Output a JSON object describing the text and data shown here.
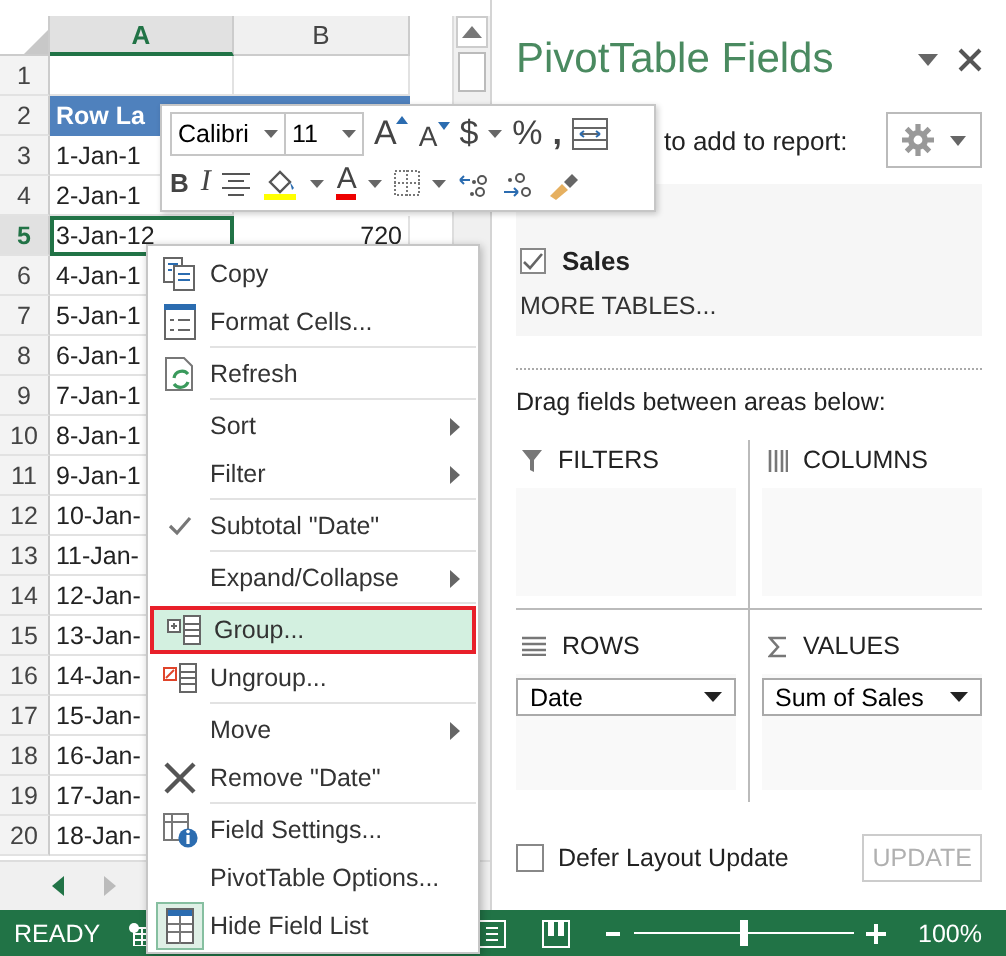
{
  "sheet": {
    "columns": [
      {
        "label": "A",
        "selected": true
      },
      {
        "label": "B",
        "selected": false
      }
    ],
    "rows": [
      {
        "number": "1",
        "kind": "blank",
        "selected": false
      },
      {
        "number": "2",
        "kind": "header",
        "a": "Row La",
        "selected": false
      },
      {
        "number": "3",
        "kind": "data",
        "a": "1-Jan-1",
        "selected": false
      },
      {
        "number": "4",
        "kind": "data",
        "a": "2-Jan-1",
        "selected": false
      },
      {
        "number": "5",
        "kind": "data",
        "a": "3-Jan-12",
        "b": "720",
        "selected": true
      },
      {
        "number": "6",
        "kind": "data",
        "a": "4-Jan-1",
        "selected": false
      },
      {
        "number": "7",
        "kind": "data",
        "a": "5-Jan-1",
        "selected": false
      },
      {
        "number": "8",
        "kind": "data",
        "a": "6-Jan-1",
        "selected": false
      },
      {
        "number": "9",
        "kind": "data",
        "a": "7-Jan-1",
        "selected": false
      },
      {
        "number": "10",
        "kind": "data",
        "a": "8-Jan-1",
        "selected": false
      },
      {
        "number": "11",
        "kind": "data",
        "a": "9-Jan-1",
        "selected": false
      },
      {
        "number": "12",
        "kind": "data",
        "a": "10-Jan-",
        "selected": false
      },
      {
        "number": "13",
        "kind": "data",
        "a": "11-Jan-",
        "selected": false
      },
      {
        "number": "14",
        "kind": "data",
        "a": "12-Jan-",
        "selected": false
      },
      {
        "number": "15",
        "kind": "data",
        "a": "13-Jan-",
        "selected": false
      },
      {
        "number": "16",
        "kind": "data",
        "a": "14-Jan-",
        "selected": false
      },
      {
        "number": "17",
        "kind": "data",
        "a": "15-Jan-",
        "selected": false
      },
      {
        "number": "18",
        "kind": "data",
        "a": "16-Jan-",
        "selected": false
      },
      {
        "number": "19",
        "kind": "data",
        "a": "17-Jan-",
        "selected": false
      },
      {
        "number": "20",
        "kind": "data",
        "a": "18-Jan-",
        "selected": false
      }
    ]
  },
  "mini_toolbar": {
    "font_name": "Calibri",
    "font_size": "11",
    "grow_font": "A",
    "shrink_font": "A",
    "currency": "$",
    "percent": "%",
    "comma": ",",
    "bold": "B",
    "italic": "I",
    "font_color": "A"
  },
  "context_menu": {
    "items": [
      {
        "kind": "item",
        "label": "Copy",
        "submenu": false,
        "checked": false,
        "selected": false
      },
      {
        "kind": "item",
        "label": "Format Cells...",
        "submenu": false,
        "checked": false,
        "selected": false
      },
      {
        "kind": "separator"
      },
      {
        "kind": "item",
        "label": "Refresh",
        "submenu": false,
        "checked": false,
        "selected": false
      },
      {
        "kind": "separator"
      },
      {
        "kind": "item",
        "label": "Sort",
        "submenu": true,
        "checked": false,
        "selected": false
      },
      {
        "kind": "item",
        "label": "Filter",
        "submenu": true,
        "checked": false,
        "selected": false
      },
      {
        "kind": "separator"
      },
      {
        "kind": "item",
        "label": "Subtotal \"Date\"",
        "submenu": false,
        "checked": true,
        "selected": false
      },
      {
        "kind": "separator"
      },
      {
        "kind": "item",
        "label": "Expand/Collapse",
        "submenu": true,
        "checked": false,
        "selected": false
      },
      {
        "kind": "separator"
      },
      {
        "kind": "item",
        "label": "Group...",
        "submenu": false,
        "checked": false,
        "selected": true
      },
      {
        "kind": "item",
        "label": "Ungroup...",
        "submenu": false,
        "checked": false,
        "selected": false
      },
      {
        "kind": "separator"
      },
      {
        "kind": "item",
        "label": "Move",
        "submenu": true,
        "checked": false,
        "selected": false
      },
      {
        "kind": "item",
        "label": "Remove \"Date\"",
        "submenu": false,
        "checked": false,
        "selected": false
      },
      {
        "kind": "separator"
      },
      {
        "kind": "item",
        "label": "Field Settings...",
        "submenu": false,
        "checked": false,
        "selected": false
      },
      {
        "kind": "item",
        "label": "PivotTable Options...",
        "submenu": false,
        "checked": false,
        "selected": false
      },
      {
        "kind": "item",
        "label": "Hide Field List",
        "submenu": false,
        "checked": true,
        "selected": false
      }
    ]
  },
  "pivot_fields": {
    "title": "PivotTable Fields",
    "choose_label": "to add to report:",
    "fields": [
      {
        "label": "Sales",
        "checked": true
      }
    ],
    "more_tables": "MORE TABLES...",
    "drag_hint": "Drag fields between areas below:",
    "areas": [
      {
        "kind": "filters",
        "title": "FILTERS"
      },
      {
        "kind": "columns",
        "title": "COLUMNS"
      },
      {
        "kind": "rows",
        "title": "ROWS",
        "items": [
          "Date"
        ]
      },
      {
        "kind": "values",
        "title": "VALUES",
        "items": [
          "Sum of Sales"
        ]
      }
    ],
    "defer": {
      "label": "Defer Layout Update",
      "checked": false
    },
    "update_button": {
      "label": "UPDATE",
      "disabled": true
    }
  },
  "status_bar": {
    "mode": "READY",
    "zoom": "100%",
    "level": 0.5
  }
}
